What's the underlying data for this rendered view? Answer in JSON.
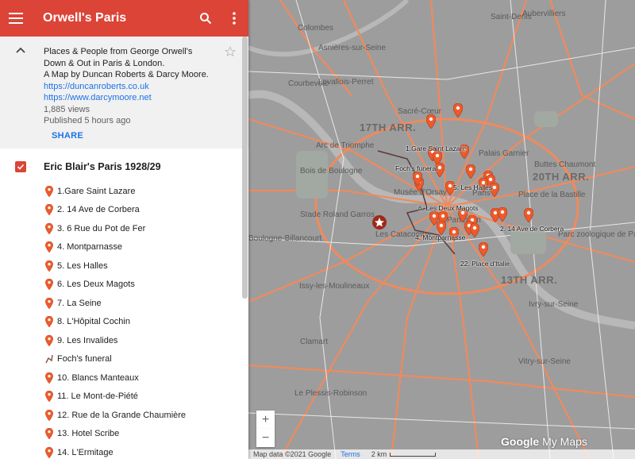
{
  "header": {
    "title": "Orwell's Paris",
    "menu_icon": "hamburger-icon",
    "search_icon": "search-icon",
    "more_icon": "more-vert-icon",
    "color": "#db4437"
  },
  "info": {
    "description_lines": [
      "Places & People from George Orwell's",
      "Down & Out in Paris & London.",
      "A Map by Duncan Roberts & Darcy Moore."
    ],
    "links": [
      "https://duncanroberts.co.uk",
      "https://www.darcymoore.net"
    ],
    "views": "1,885 views",
    "published": "Published 5 hours ago",
    "share_label": "SHARE"
  },
  "layer": {
    "name": "Eric Blair's Paris 1928/29",
    "checked": true,
    "items": [
      {
        "label": "1.Gare Saint Lazare",
        "icon": "pin"
      },
      {
        "label": "2. 14 Ave de Corbera",
        "icon": "pin"
      },
      {
        "label": "3. 6 Rue du Pot de Fer",
        "icon": "pin"
      },
      {
        "label": "4. Montparnasse",
        "icon": "pin"
      },
      {
        "label": "5. Les Halles",
        "icon": "pin"
      },
      {
        "label": "6. Les Deux Magots",
        "icon": "pin"
      },
      {
        "label": "7. La Seine",
        "icon": "pin"
      },
      {
        "label": "8. L'Hôpital Cochin",
        "icon": "pin"
      },
      {
        "label": "9. Les Invalides",
        "icon": "pin"
      },
      {
        "label": "Foch's funeral",
        "icon": "line"
      },
      {
        "label": "10. Blancs Manteaux",
        "icon": "pin"
      },
      {
        "label": "11. Le Mont-de-Piété",
        "icon": "pin"
      },
      {
        "label": "12. Rue de la Grande Chaumière",
        "icon": "pin"
      },
      {
        "label": "13. Hotel Scribe",
        "icon": "pin"
      },
      {
        "label": "14. L'Ermitage",
        "icon": "pin"
      }
    ]
  },
  "map": {
    "places": [
      "Colombes",
      "Asnières-sur-Seine",
      "Saint-Denis",
      "Aubervilliers",
      "Courbevoie",
      "Levallois-Perret",
      "Sacré-Cœur",
      "17TH ARR.",
      "Arc de Triomphe",
      "Palais Garnier",
      "Buttes Chaumont",
      "20TH ARR.",
      "Bois de Boulogne",
      "Musée d'Orsay",
      "Paris",
      "Place de la Bastille",
      "Stade Roland Garros",
      "Les Catacombs",
      "Panthéon",
      "Boulogne-Billancourt",
      "Parc zoologique de Paris",
      "13TH ARR.",
      "Issy-les-Moulineaux",
      "Ivry-sur-Seine",
      "Clamart",
      "Vitry-sur-Seine",
      "Le Plessis-Robinson"
    ],
    "marker_labels": [
      "1.Gare Saint Lazare",
      "Foch's funeral",
      "5. Les Halles",
      "6. Les Deux Magots",
      "2. 14 Ave de Corbera",
      "4. Montparnasse",
      "22. Place d'Italie"
    ],
    "zoom_in": "+",
    "zoom_out": "−",
    "footer": {
      "data": "Map data ©2021 Google",
      "terms": "Terms",
      "scale": "2 km"
    },
    "logo": {
      "google": "Google",
      "suffix": "My Maps"
    },
    "pin_color": "#ee5a2a"
  }
}
